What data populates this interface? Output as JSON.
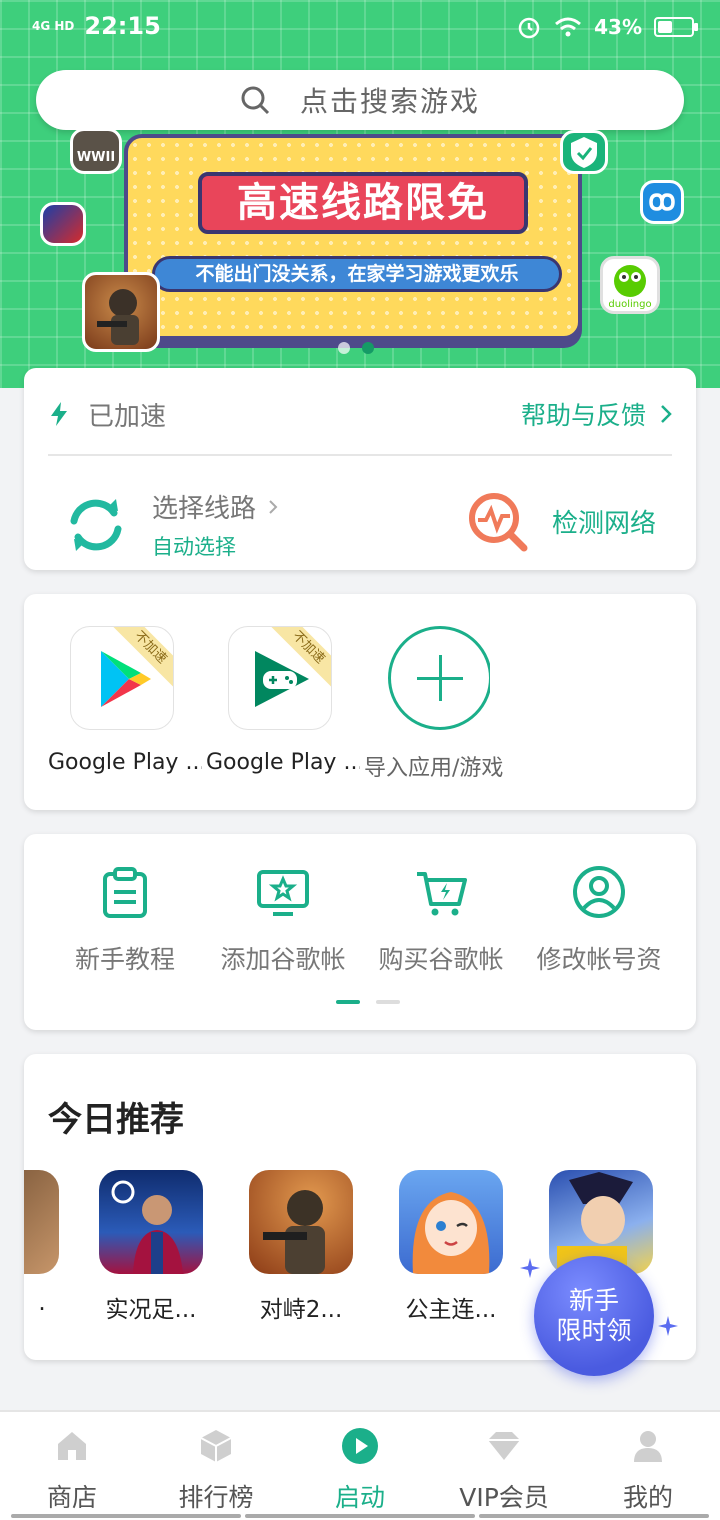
{
  "status_bar": {
    "network": "4G HD",
    "time": "22:15",
    "battery": "43%",
    "battery_level": 0.43
  },
  "search": {
    "placeholder": "点击搜索游戏"
  },
  "banner": {
    "title": "高速线路限免",
    "subtitle": "不能出门没关系，在家学习游戏更欢乐",
    "badge_wwii": "WWII",
    "badge_duolingo": "duolingo",
    "slide_count": 2,
    "active_slide": 2
  },
  "accel": {
    "status": "已加速",
    "help": "帮助与反馈",
    "route_label": "选择线路",
    "route_value": "自动选择",
    "detect": "检测网络"
  },
  "apps": {
    "items": [
      {
        "label": "Google Play ...",
        "ribbon": "不加速"
      },
      {
        "label": "Google Play ...",
        "ribbon": "不加速"
      }
    ],
    "import_label": "导入应用/游戏"
  },
  "tools": {
    "items": [
      {
        "label": "新手教程",
        "icon": "clipboard-icon"
      },
      {
        "label": "添加谷歌帐",
        "icon": "monitor-star-icon"
      },
      {
        "label": "购买谷歌帐",
        "icon": "cart-bolt-icon"
      },
      {
        "label": "修改帐号资",
        "icon": "user-circle-icon"
      }
    ]
  },
  "recommend": {
    "title": "今日推荐",
    "games": [
      {
        "name": "."
      },
      {
        "name": "实况足..."
      },
      {
        "name": "对峙2..."
      },
      {
        "name": "公主连..."
      },
      {
        "name": ""
      }
    ]
  },
  "promo": {
    "line1": "新手",
    "line2": "限时领"
  },
  "nav": {
    "items": [
      {
        "label": "商店",
        "icon": "home-icon"
      },
      {
        "label": "排行榜",
        "icon": "cube-icon"
      },
      {
        "label": "启动",
        "icon": "play-icon"
      },
      {
        "label": "VIP会员",
        "icon": "diamond-icon"
      },
      {
        "label": "我的",
        "icon": "person-icon"
      }
    ],
    "active": "启动"
  },
  "colors": {
    "accent": "#1baf8a",
    "hero": "#3ecf7c",
    "promo": "#4a5be0"
  }
}
